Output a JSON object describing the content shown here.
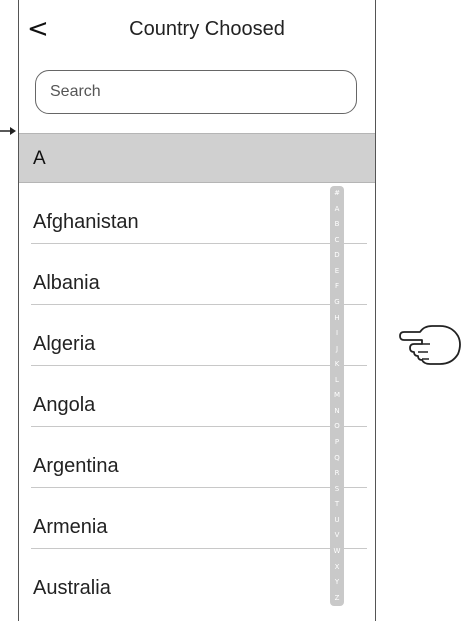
{
  "header": {
    "back_symbol": "<",
    "title": "Country Choosed"
  },
  "search": {
    "placeholder": "Search",
    "value": ""
  },
  "section": {
    "label": "A"
  },
  "countries": [
    "Afghanistan",
    "Albania",
    "Algeria",
    "Angola",
    "Argentina",
    "Armenia",
    "Australia"
  ],
  "alphabet_index": [
    "#",
    "A",
    "B",
    "C",
    "D",
    "E",
    "F",
    "G",
    "H",
    "I",
    "J",
    "K",
    "L",
    "M",
    "N",
    "O",
    "P",
    "Q",
    "R",
    "S",
    "T",
    "U",
    "V",
    "W",
    "X",
    "Y",
    "Z"
  ],
  "icons": {
    "back": "chevron-left-icon",
    "pointer": "pointing-hand-icon",
    "arrow": "arrow-right-icon"
  },
  "colors": {
    "section_bg": "#d0d0d0",
    "index_bg": "#c9c9c9",
    "index_text": "#ffffff",
    "divider": "#c8c8c8"
  }
}
